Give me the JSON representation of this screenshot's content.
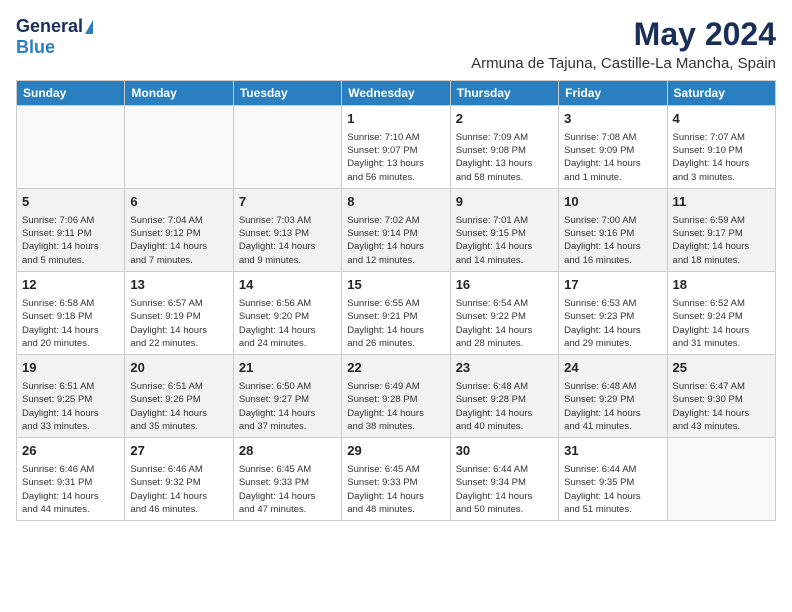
{
  "logo": {
    "general": "General",
    "blue": "Blue"
  },
  "title": {
    "month_year": "May 2024",
    "location": "Armuna de Tajuna, Castille-La Mancha, Spain"
  },
  "days_of_week": [
    "Sunday",
    "Monday",
    "Tuesday",
    "Wednesday",
    "Thursday",
    "Friday",
    "Saturday"
  ],
  "weeks": [
    {
      "shaded": false,
      "days": [
        {
          "num": "",
          "text": ""
        },
        {
          "num": "",
          "text": ""
        },
        {
          "num": "",
          "text": ""
        },
        {
          "num": "1",
          "text": "Sunrise: 7:10 AM\nSunset: 9:07 PM\nDaylight: 13 hours\nand 56 minutes."
        },
        {
          "num": "2",
          "text": "Sunrise: 7:09 AM\nSunset: 9:08 PM\nDaylight: 13 hours\nand 58 minutes."
        },
        {
          "num": "3",
          "text": "Sunrise: 7:08 AM\nSunset: 9:09 PM\nDaylight: 14 hours\nand 1 minute."
        },
        {
          "num": "4",
          "text": "Sunrise: 7:07 AM\nSunset: 9:10 PM\nDaylight: 14 hours\nand 3 minutes."
        }
      ]
    },
    {
      "shaded": true,
      "days": [
        {
          "num": "5",
          "text": "Sunrise: 7:06 AM\nSunset: 9:11 PM\nDaylight: 14 hours\nand 5 minutes."
        },
        {
          "num": "6",
          "text": "Sunrise: 7:04 AM\nSunset: 9:12 PM\nDaylight: 14 hours\nand 7 minutes."
        },
        {
          "num": "7",
          "text": "Sunrise: 7:03 AM\nSunset: 9:13 PM\nDaylight: 14 hours\nand 9 minutes."
        },
        {
          "num": "8",
          "text": "Sunrise: 7:02 AM\nSunset: 9:14 PM\nDaylight: 14 hours\nand 12 minutes."
        },
        {
          "num": "9",
          "text": "Sunrise: 7:01 AM\nSunset: 9:15 PM\nDaylight: 14 hours\nand 14 minutes."
        },
        {
          "num": "10",
          "text": "Sunrise: 7:00 AM\nSunset: 9:16 PM\nDaylight: 14 hours\nand 16 minutes."
        },
        {
          "num": "11",
          "text": "Sunrise: 6:59 AM\nSunset: 9:17 PM\nDaylight: 14 hours\nand 18 minutes."
        }
      ]
    },
    {
      "shaded": false,
      "days": [
        {
          "num": "12",
          "text": "Sunrise: 6:58 AM\nSunset: 9:18 PM\nDaylight: 14 hours\nand 20 minutes."
        },
        {
          "num": "13",
          "text": "Sunrise: 6:57 AM\nSunset: 9:19 PM\nDaylight: 14 hours\nand 22 minutes."
        },
        {
          "num": "14",
          "text": "Sunrise: 6:56 AM\nSunset: 9:20 PM\nDaylight: 14 hours\nand 24 minutes."
        },
        {
          "num": "15",
          "text": "Sunrise: 6:55 AM\nSunset: 9:21 PM\nDaylight: 14 hours\nand 26 minutes."
        },
        {
          "num": "16",
          "text": "Sunrise: 6:54 AM\nSunset: 9:22 PM\nDaylight: 14 hours\nand 28 minutes."
        },
        {
          "num": "17",
          "text": "Sunrise: 6:53 AM\nSunset: 9:23 PM\nDaylight: 14 hours\nand 29 minutes."
        },
        {
          "num": "18",
          "text": "Sunrise: 6:52 AM\nSunset: 9:24 PM\nDaylight: 14 hours\nand 31 minutes."
        }
      ]
    },
    {
      "shaded": true,
      "days": [
        {
          "num": "19",
          "text": "Sunrise: 6:51 AM\nSunset: 9:25 PM\nDaylight: 14 hours\nand 33 minutes."
        },
        {
          "num": "20",
          "text": "Sunrise: 6:51 AM\nSunset: 9:26 PM\nDaylight: 14 hours\nand 35 minutes."
        },
        {
          "num": "21",
          "text": "Sunrise: 6:50 AM\nSunset: 9:27 PM\nDaylight: 14 hours\nand 37 minutes."
        },
        {
          "num": "22",
          "text": "Sunrise: 6:49 AM\nSunset: 9:28 PM\nDaylight: 14 hours\nand 38 minutes."
        },
        {
          "num": "23",
          "text": "Sunrise: 6:48 AM\nSunset: 9:28 PM\nDaylight: 14 hours\nand 40 minutes."
        },
        {
          "num": "24",
          "text": "Sunrise: 6:48 AM\nSunset: 9:29 PM\nDaylight: 14 hours\nand 41 minutes."
        },
        {
          "num": "25",
          "text": "Sunrise: 6:47 AM\nSunset: 9:30 PM\nDaylight: 14 hours\nand 43 minutes."
        }
      ]
    },
    {
      "shaded": false,
      "days": [
        {
          "num": "26",
          "text": "Sunrise: 6:46 AM\nSunset: 9:31 PM\nDaylight: 14 hours\nand 44 minutes."
        },
        {
          "num": "27",
          "text": "Sunrise: 6:46 AM\nSunset: 9:32 PM\nDaylight: 14 hours\nand 46 minutes."
        },
        {
          "num": "28",
          "text": "Sunrise: 6:45 AM\nSunset: 9:33 PM\nDaylight: 14 hours\nand 47 minutes."
        },
        {
          "num": "29",
          "text": "Sunrise: 6:45 AM\nSunset: 9:33 PM\nDaylight: 14 hours\nand 48 minutes."
        },
        {
          "num": "30",
          "text": "Sunrise: 6:44 AM\nSunset: 9:34 PM\nDaylight: 14 hours\nand 50 minutes."
        },
        {
          "num": "31",
          "text": "Sunrise: 6:44 AM\nSunset: 9:35 PM\nDaylight: 14 hours\nand 51 minutes."
        },
        {
          "num": "",
          "text": ""
        }
      ]
    }
  ]
}
